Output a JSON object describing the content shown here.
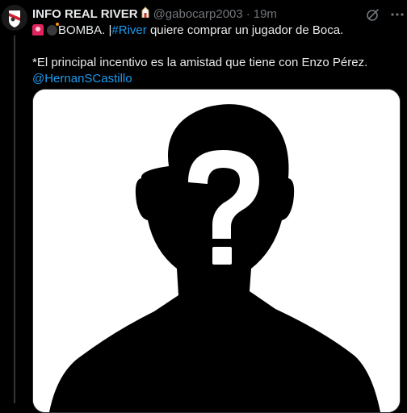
{
  "tweet": {
    "display_name": "INFO REAL RIVER",
    "handle": "@gabocarp2003",
    "separator": "·",
    "time": "19m",
    "text_line1_bomba": "BOMBA. |",
    "text_line1_hashtag": "#River",
    "text_line1_rest": " quiere comprar un jugador de Boca.",
    "text_line2": "*El principal incentivo es la amistad que tiene con Enzo Pérez.",
    "text_line3_mention": "@HernanSCastillo",
    "icons": {
      "avatar": "river-plate-crest",
      "badge": "building-badge-icon",
      "grok": "grok-icon",
      "more": "more-icon",
      "emoji1": "siren-icon",
      "emoji2": "bomb-icon"
    },
    "media": {
      "subject": "mystery-silhouette-question-mark"
    }
  },
  "colors": {
    "background": "#000000",
    "text": "#e7e9ea",
    "secondary": "#71767b",
    "link": "#1d9bf0",
    "border": "#2f3336"
  }
}
